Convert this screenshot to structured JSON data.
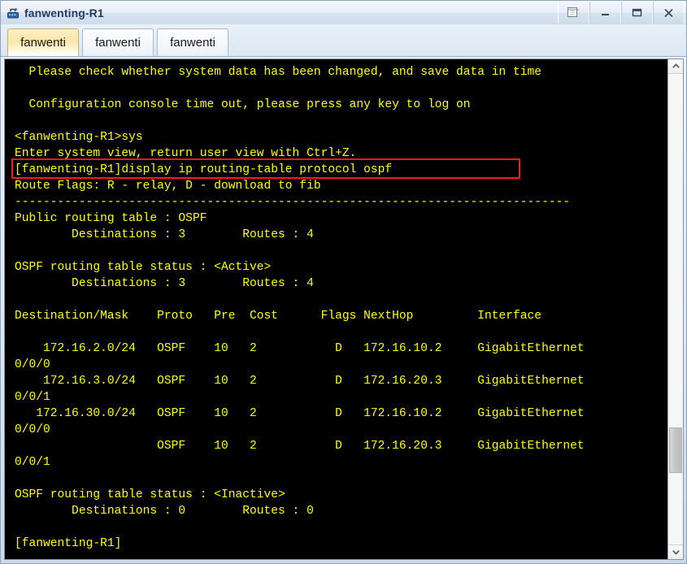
{
  "window": {
    "title": "fanwenting-R1",
    "icon": "router-icon",
    "controls": [
      {
        "name": "restore-button",
        "glyph": "restore-icon",
        "label": "Restore"
      },
      {
        "name": "minimize-button",
        "glyph": "minimize-icon",
        "label": "_"
      },
      {
        "name": "maximize-button",
        "glyph": "maximize-icon",
        "label": "□"
      },
      {
        "name": "close-button",
        "glyph": "close-icon",
        "label": "X"
      }
    ]
  },
  "tabs": [
    {
      "label": "fanwenti",
      "active": true
    },
    {
      "label": "fanwenti",
      "active": false
    },
    {
      "label": "fanwenti",
      "active": false
    }
  ],
  "terminal": {
    "fg_color": "#ffff00",
    "bg_color": "#000000",
    "highlight_color": "#ff1a1a",
    "lines": [
      "  Please check whether system data has been changed, and save data in time",
      "",
      "  Configuration console time out, please press any key to log on",
      "",
      "<fanwenting-R1>sys",
      "Enter system view, return user view with Ctrl+Z.",
      "[fanwenting-R1]display ip routing-table protocol ospf",
      "Route Flags: R - relay, D - download to fib",
      "------------------------------------------------------------------------------",
      "Public routing table : OSPF",
      "        Destinations : 3        Routes : 4",
      "",
      "OSPF routing table status : <Active>",
      "        Destinations : 3        Routes : 4",
      "",
      "Destination/Mask    Proto   Pre  Cost      Flags NextHop         Interface",
      "",
      "    172.16.2.0/24   OSPF    10   2           D   172.16.10.2     GigabitEthernet",
      "0/0/0",
      "    172.16.3.0/24   OSPF    10   2           D   172.16.20.3     GigabitEthernet",
      "0/0/1",
      "   172.16.30.0/24   OSPF    10   2           D   172.16.10.2     GigabitEthernet",
      "0/0/0",
      "                    OSPF    10   2           D   172.16.20.3     GigabitEthernet",
      "0/0/1",
      "",
      "OSPF routing table status : <Inactive>",
      "        Destinations : 0        Routes : 0",
      "",
      "[fanwenting-R1]"
    ],
    "highlighted_command": "[fanwenting-R1]display ip routing-table protocol ospf"
  },
  "routing_table": {
    "columns": [
      "Destination/Mask",
      "Proto",
      "Pre",
      "Cost",
      "Flags",
      "NextHop",
      "Interface"
    ],
    "rows": [
      [
        "172.16.2.0/24",
        "OSPF",
        "10",
        "2",
        "D",
        "172.16.10.2",
        "GigabitEthernet0/0/0"
      ],
      [
        "172.16.3.0/24",
        "OSPF",
        "10",
        "2",
        "D",
        "172.16.20.3",
        "GigabitEthernet0/0/1"
      ],
      [
        "172.16.30.0/24",
        "OSPF",
        "10",
        "2",
        "D",
        "172.16.10.2",
        "GigabitEthernet0/0/0"
      ],
      [
        "",
        "OSPF",
        "10",
        "2",
        "D",
        "172.16.20.3",
        "GigabitEthernet0/0/1"
      ]
    ],
    "public_table": {
      "protocol": "OSPF",
      "destinations": "3",
      "routes": "4"
    },
    "active_status": {
      "status": "<Active>",
      "destinations": "3",
      "routes": "4"
    },
    "inactive_status": {
      "status": "<Inactive>",
      "destinations": "0",
      "routes": "0"
    },
    "route_flags": "R - relay, D - download to fib"
  },
  "scrollbar": {
    "up_arrow": "chevron-up-icon",
    "down_arrow": "chevron-down-icon"
  }
}
